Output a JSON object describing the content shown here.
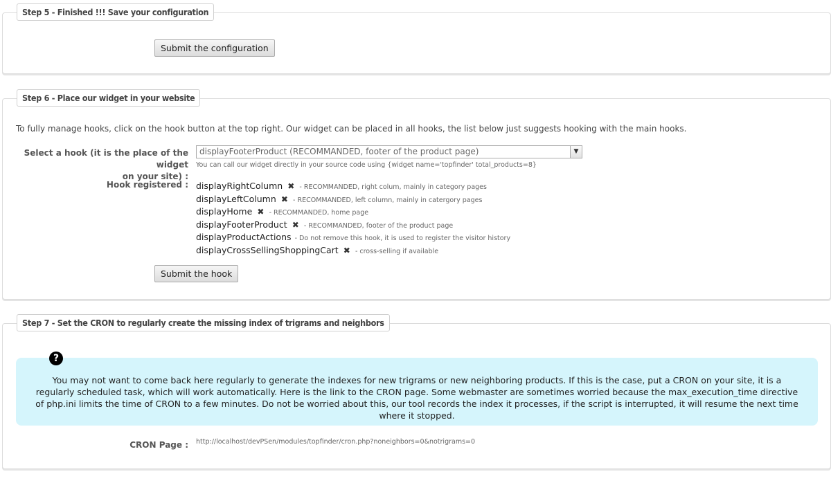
{
  "step5": {
    "title": "Step 5 - Finished !!! Save your configuration",
    "submit_label": "Submit the configuration"
  },
  "step6": {
    "title": "Step 6 - Place our widget in your website",
    "intro": "To fully manage hooks, click on the hook button at the top right. Our widget can be placed in all hooks, the list below just suggests hooking with the main hooks.",
    "select_label_line1": "Select a hook (it is the place of the widget",
    "select_label_line2": "on your site) :",
    "select_value": "displayFooterProduct (RECOMMANDED, footer of the product page)",
    "hint": "You can call our widget directly in your source code using {widget name='topfinder' total_products=8}",
    "hooks_label": "Hook registered :",
    "hooks": [
      {
        "name": "displayRightColumn",
        "remove_icon": "✖",
        "desc": "- RECOMMANDED, right colum, mainly in category pages"
      },
      {
        "name": "displayLeftColumn",
        "remove_icon": "✖",
        "desc": "- RECOMMANDED, left column, mainly in catergory pages"
      },
      {
        "name": "displayHome",
        "remove_icon": "✖",
        "desc": "- RECOMMANDED, home page"
      },
      {
        "name": "displayFooterProduct",
        "remove_icon": "✖",
        "desc": "- RECOMMANDED, footer of the product page"
      },
      {
        "name": "displayProductActions",
        "desc": "- Do not remove this hook, it is used to register the visitor history"
      },
      {
        "name": "displayCrossSellingShoppingCart",
        "remove_icon": "✖",
        "desc": "- cross-selling if available"
      }
    ],
    "submit_label": "Submit the hook"
  },
  "step7": {
    "title": "Step 7 - Set the CRON to regularly create the missing index of trigrams and neighbors",
    "help_icon": "?",
    "info": "You may not want to come back here regularly to generate the indexes for new trigrams or new neighboring products. If this is the case, put a CRON on your site, it is a regularly scheduled task, which will work automatically. Here is the link to the CRON page. Some webmaster are sometimes worried because the max_execution_time directive of php.ini limits the time of CRON to a few minutes. Do not be worried about this, our tool records the index it processes, if the script is interrupted, it will resume the next time where it stopped.",
    "cron_label": "CRON Page :",
    "cron_url": "http://localhost/devPSen/modules/topfinder/cron.php?noneighbors=0&notrigrams=0"
  },
  "colors": {
    "info_background": "#d5f5fc",
    "panel_border": "#dcdcdc"
  }
}
